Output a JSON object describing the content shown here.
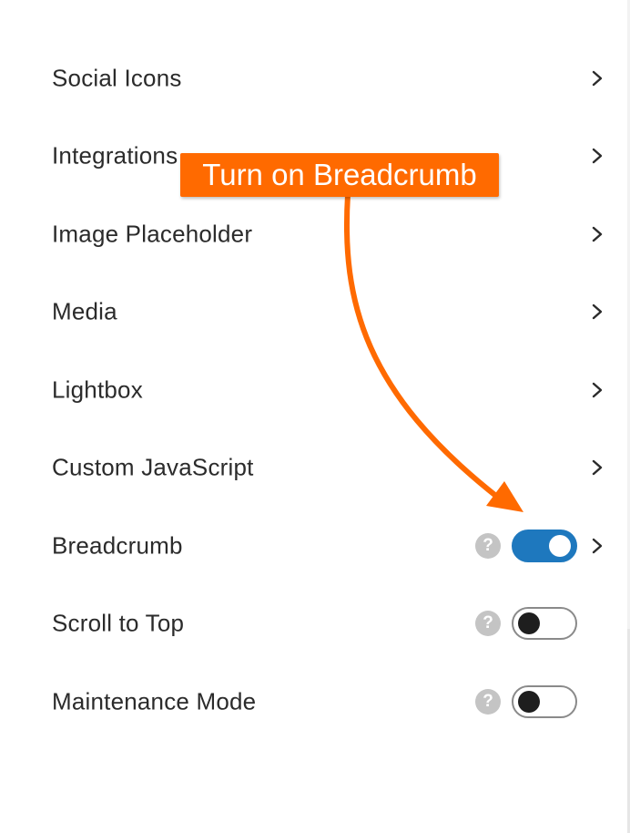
{
  "settings": {
    "items": [
      {
        "label": "Social Icons",
        "has_chevron": true
      },
      {
        "label": "Integrations",
        "has_chevron": true
      },
      {
        "label": "Image Placeholder",
        "has_chevron": true
      },
      {
        "label": "Media",
        "has_chevron": true
      },
      {
        "label": "Lightbox",
        "has_chevron": true
      },
      {
        "label": "Custom JavaScript",
        "has_chevron": true
      },
      {
        "label": "Breadcrumb",
        "help": "?",
        "toggle": "on",
        "has_chevron": true
      },
      {
        "label": "Scroll to Top",
        "help": "?",
        "toggle": "off",
        "has_chevron": false
      },
      {
        "label": "Maintenance Mode",
        "help": "?",
        "toggle": "off",
        "has_chevron": false
      }
    ]
  },
  "annotation": {
    "callout_text": "Turn on Breadcrumb",
    "color": "#ff6a00"
  },
  "colors": {
    "toggle_on": "#1e78be",
    "help_icon": "#c4c4c4",
    "text": "#2b2b2b"
  },
  "icons": {
    "chevron": "chevron-right-icon",
    "help": "question-mark-icon",
    "arrow": "curved-arrow-icon"
  }
}
